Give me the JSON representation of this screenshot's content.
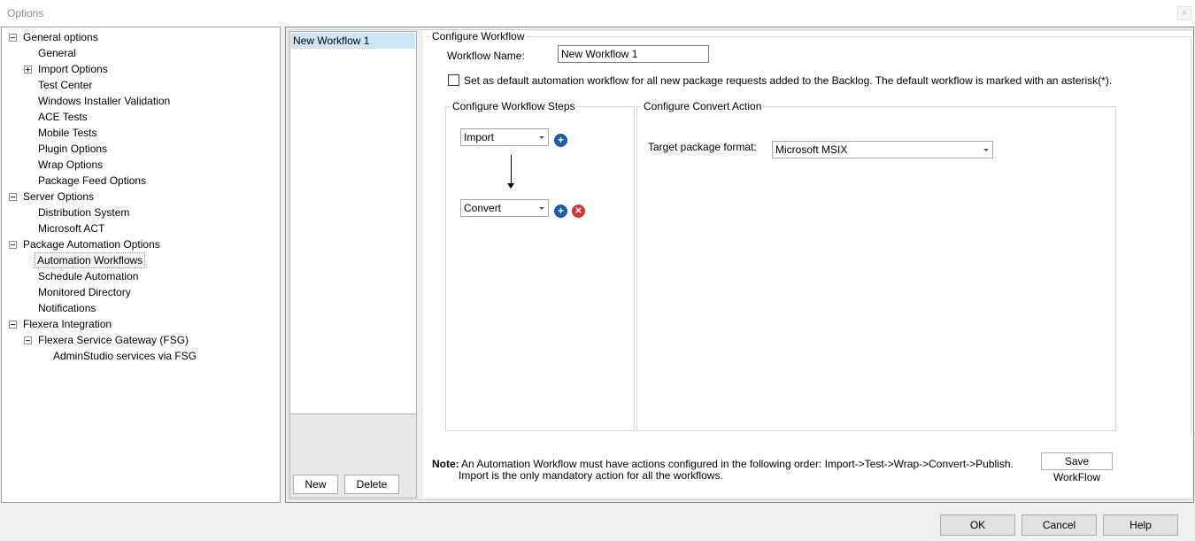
{
  "window": {
    "title": "Options",
    "close_label": "x"
  },
  "tree": {
    "items": [
      {
        "label": "General options",
        "expander": "minus"
      },
      {
        "label": "General"
      },
      {
        "label": "Import Options",
        "expander": "plus"
      },
      {
        "label": "Test Center"
      },
      {
        "label": "Windows Installer Validation"
      },
      {
        "label": "ACE Tests"
      },
      {
        "label": "Mobile Tests"
      },
      {
        "label": "Plugin Options"
      },
      {
        "label": "Wrap Options"
      },
      {
        "label": "Package Feed Options"
      },
      {
        "label": "Server Options",
        "expander": "minus"
      },
      {
        "label": "Distribution System"
      },
      {
        "label": "Microsoft ACT"
      },
      {
        "label": "Package Automation Options",
        "expander": "minus"
      },
      {
        "label": "Automation Workflows",
        "selected": true
      },
      {
        "label": "Schedule Automation"
      },
      {
        "label": "Monitored Directory"
      },
      {
        "label": "Notifications"
      },
      {
        "label": "Flexera Integration",
        "expander": "minus"
      },
      {
        "label": "Flexera Service Gateway (FSG)",
        "expander": "minus"
      },
      {
        "label": "AdminStudio services via FSG"
      }
    ]
  },
  "workflow_list": {
    "items": [
      "New Workflow 1"
    ],
    "new_label": "New",
    "delete_label": "Delete"
  },
  "configure": {
    "group_title": "Configure Workflow",
    "name_label": "Workflow Name:",
    "name_value": "New Workflow 1",
    "default_checkbox_label": "Set as default automation workflow for all new package requests added to the Backlog. The default workflow is marked with an asterisk(*).",
    "default_checked": false,
    "steps_title": "Configure Workflow Steps",
    "steps": [
      "Import",
      "Convert"
    ],
    "action_title": "Configure Convert Action",
    "target_format_label": "Target package format:",
    "target_format_value": "Microsoft MSIX",
    "note_prefix": "Note:",
    "note_line1": "An Automation Workflow must have actions configured in the following order: Import->Test->Wrap->Convert->Publish.",
    "note_line2": "Import is the only mandatory action for all the workflows.",
    "save_label": "Save WorkFlow"
  },
  "footer": {
    "ok_label": "OK",
    "cancel_label": "Cancel",
    "help_label": "Help"
  },
  "colors": {
    "selection": "#cde6f7",
    "plus_icon": "#1a5aa6",
    "remove_icon": "#d23535"
  }
}
